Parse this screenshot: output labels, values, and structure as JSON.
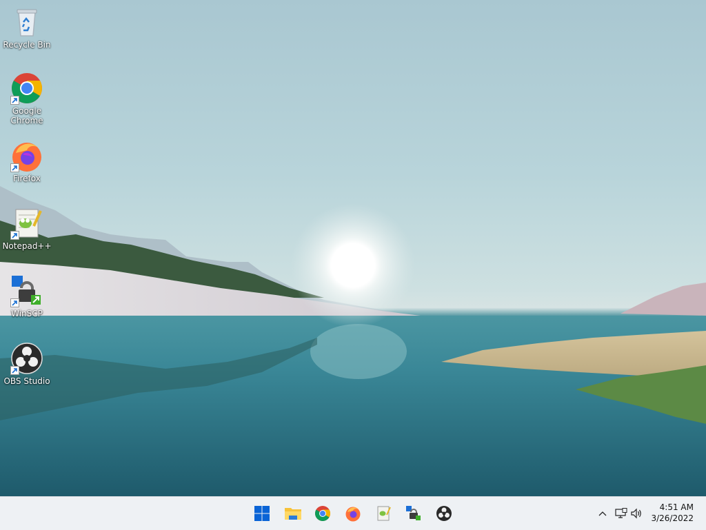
{
  "desktop_icons": [
    {
      "label": "Recycle Bin",
      "icon": "recycle-bin-icon"
    },
    {
      "label": "Google Chrome",
      "icon": "chrome-icon"
    },
    {
      "label": "Firefox",
      "icon": "firefox-icon"
    },
    {
      "label": "Notepad++",
      "icon": "notepadpp-icon"
    },
    {
      "label": "WinSCP",
      "icon": "winscp-icon"
    },
    {
      "label": "OBS Studio",
      "icon": "obs-icon"
    }
  ],
  "taskbar": {
    "pinned": [
      "start-icon",
      "file-explorer-icon",
      "chrome-icon",
      "firefox-icon",
      "notepadpp-icon",
      "winscp-icon",
      "obs-icon"
    ],
    "tray_icons": [
      "chevron-up-icon",
      "network-icon",
      "volume-icon"
    ]
  },
  "clock": {
    "time": "4:51 AM",
    "date": "3/26/2022"
  },
  "colors": {
    "taskbar_bg": "#eef1f4",
    "start_blue": "#0a64d6"
  }
}
